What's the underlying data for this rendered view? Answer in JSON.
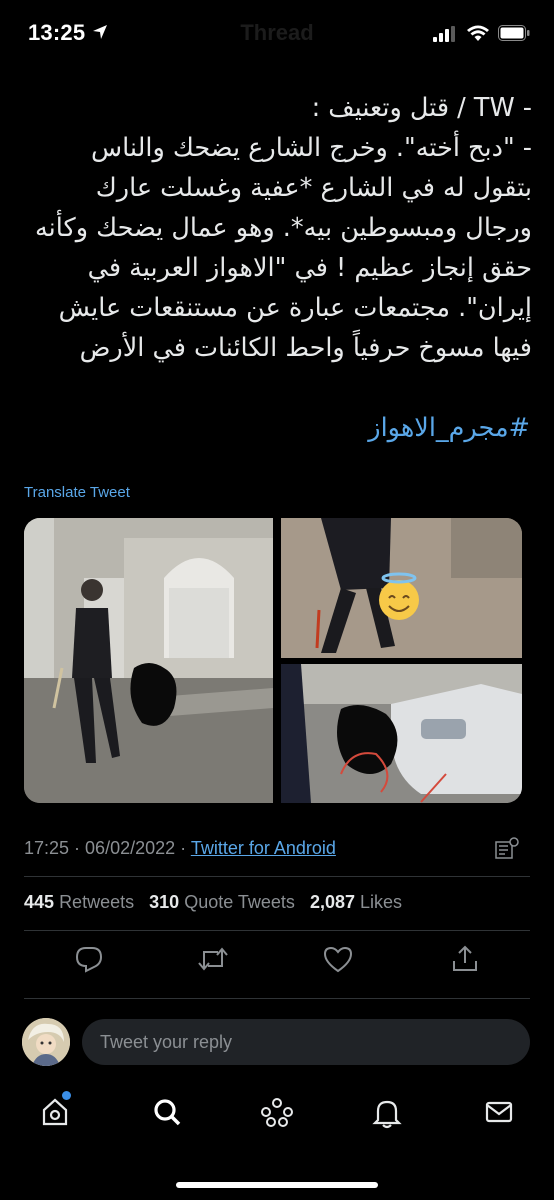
{
  "status_bar": {
    "time": "13:25",
    "screen_title": "Thread"
  },
  "tweet": {
    "body": "- TW / قتل وتعنيف :\n- \"دبح أخته\". وخرج الشارع يضحك والناس بتقول له في الشارع *عفية وغسلت عارك ورجال ومبسوطين بيه*. وهو عمال يضحك وكأنه حقق إنجاز عظيم ! في \"الاهواز العربية في إيران\". مجتمعات عبارة عن مستنقعات عايش فيها مسوخ حرفياً واحط الكائنات في الأرض",
    "hashtag": "#مجرم_الاهواز",
    "translate_label": "Translate Tweet",
    "time": "17:25",
    "date": "06/02/2022",
    "source": "Twitter for Android",
    "separator": " · "
  },
  "stats": {
    "retweets_count": "445",
    "retweets_label": "Retweets",
    "quotes_count": "310",
    "quotes_label": "Quote Tweets",
    "likes_count": "2,087",
    "likes_label": "Likes"
  },
  "actions": [
    "reply-icon",
    "retweet-icon",
    "like-icon",
    "share-icon"
  ],
  "reply": {
    "placeholder": "Tweet your reply"
  },
  "tabbar": [
    "home-icon",
    "search-icon",
    "spaces-icon",
    "notifications-icon",
    "messages-icon"
  ],
  "colors": {
    "background": "#000000",
    "text": "#e7e9ea",
    "muted": "#8b8f93",
    "link": "#5aa7e8",
    "divider": "#2f3336"
  }
}
